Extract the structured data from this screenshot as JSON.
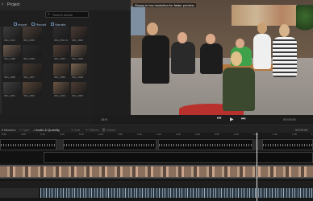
{
  "topbar": {
    "back_icon": "chevron-left-icon",
    "project_label": "Project"
  },
  "media": {
    "search_placeholder": "Search media",
    "tabs": [
      {
        "label": "Import",
        "icon": "import-icon"
      },
      {
        "label": "Record",
        "icon": "record-icon"
      },
      {
        "label": "Narrate",
        "icon": "narrate-icon"
      }
    ],
    "items": [
      {
        "caption": "IMG_2021",
        "color": "#3c3c3c"
      },
      {
        "caption": "IMG_0484",
        "color": "#4a3d36"
      },
      {
        "caption": "IMG_5641-6-2023-10-11",
        "color": "#2e2e2e"
      },
      {
        "caption": "IMG_1840",
        "color": "#4b3a33"
      },
      {
        "caption": "IMG_0488",
        "color": "#6c5a4d"
      },
      {
        "caption": "IMG_0483",
        "color": "#2b2b2b"
      },
      {
        "caption": "IMG_1844",
        "color": "#513e36"
      },
      {
        "caption": "IMG_1848",
        "color": "#6a584a"
      },
      {
        "caption": "IMG_1848",
        "color": "#333333"
      },
      {
        "caption": "IMG_1847",
        "color": "#45382f"
      },
      {
        "caption": "IMG_1850",
        "color": "#5b4a3d"
      },
      {
        "caption": "IMG_2048",
        "color": "#7a644f"
      },
      {
        "caption": "IMG_1851",
        "color": "#3f3f3f"
      },
      {
        "caption": "IMG_1849",
        "color": "#584537"
      },
      {
        "caption": "IMG_2049",
        "color": "#6a5645"
      },
      {
        "caption": "IMG_2050",
        "color": "#4d3c33"
      }
    ]
  },
  "preview": {
    "hint": "Shows in low resolution for faster preview"
  },
  "controls": {
    "layout_label": "16:9",
    "prev_icon": "skip-back-icon",
    "play_icon": "play-icon",
    "next_icon": "skip-forward-icon",
    "timecode": "00:00:00"
  },
  "timeline": {
    "tabs": [
      {
        "label": "Markers",
        "state": "normal"
      },
      {
        "label": "Split",
        "state": "dim"
      },
      {
        "label": "Audio & Quantity",
        "state": "active"
      },
      {
        "label": "Edit",
        "state": "dim"
      },
      {
        "label": "Effects",
        "state": "dim"
      },
      {
        "label": "Delete",
        "state": "dim"
      }
    ],
    "timecode": "00:00:00",
    "ruler": [
      "0:00",
      "0:05",
      "0:10",
      "0:15",
      "0:20",
      "0:25",
      "0:30",
      "0:35",
      "0:40",
      "0:45",
      "0:50",
      "0:55",
      "1:00",
      "1:05",
      "1:10",
      "1:15",
      "1:20"
    ]
  }
}
